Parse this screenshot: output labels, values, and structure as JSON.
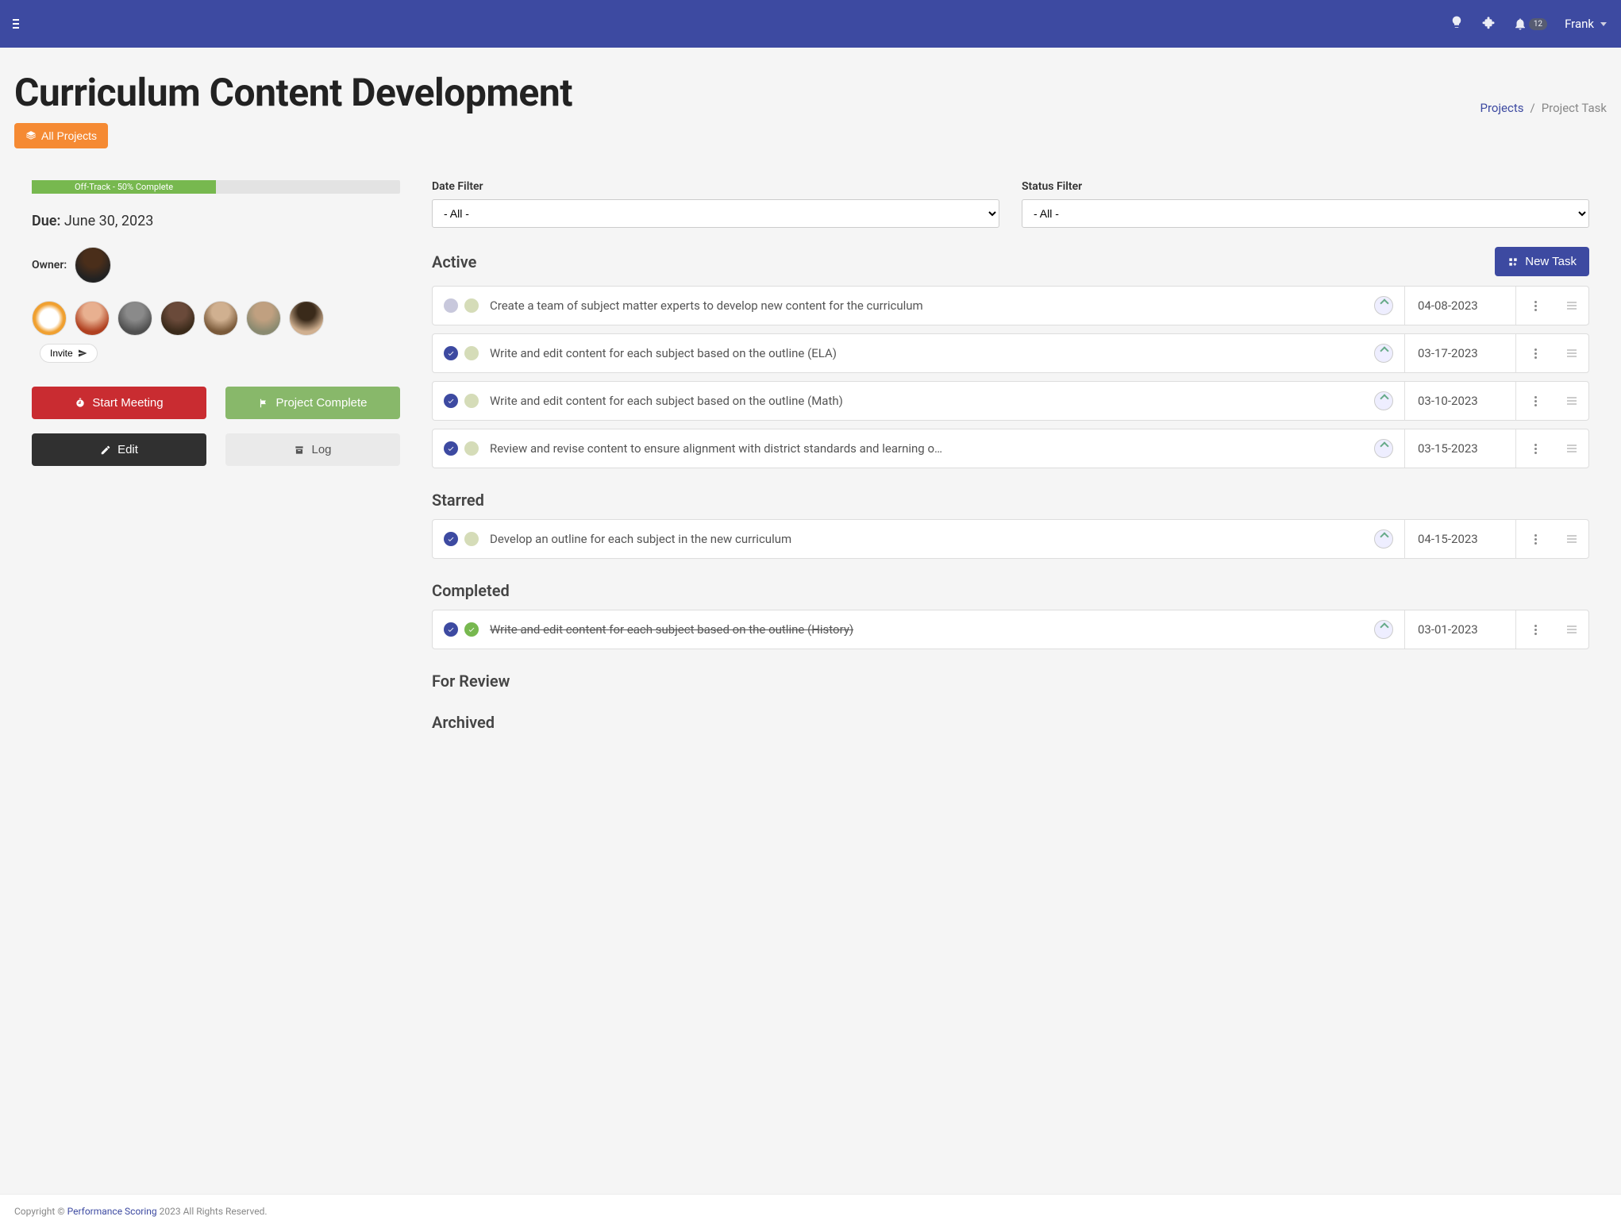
{
  "topbar": {
    "notif_count": "12",
    "username": "Frank"
  },
  "header": {
    "title": "Curriculum Content Development",
    "breadcrumb": {
      "projects": "Projects",
      "current": "Project Task"
    },
    "all_projects": "All Projects"
  },
  "project": {
    "progress_label": "Off-Track - 50% Complete",
    "due_label": "Due:",
    "due_date": "June 30, 2023",
    "owner_label": "Owner:",
    "invite_label": "Invite"
  },
  "actions": {
    "start_meeting": "Start Meeting",
    "project_complete": "Project Complete",
    "edit": "Edit",
    "log": "Log"
  },
  "filters": {
    "date_label": "Date Filter",
    "date_value": "- All -",
    "status_label": "Status Filter",
    "status_value": "- All -"
  },
  "new_task": "New Task",
  "sections": {
    "active": "Active",
    "starred": "Starred",
    "completed": "Completed",
    "for_review": "For Review",
    "archived": "Archived"
  },
  "tasks": {
    "active": [
      {
        "title": "Create a team of subject matter experts to develop new content for the curriculum",
        "date": "04-08-2023",
        "check1": "empty"
      },
      {
        "title": "Write and edit content for each subject based on the outline (ELA)",
        "date": "03-17-2023",
        "check1": "blue"
      },
      {
        "title": "Write and edit content for each subject based on the outline (Math)",
        "date": "03-10-2023",
        "check1": "blue"
      },
      {
        "title": "Review and revise content to ensure alignment with district standards and learning o…",
        "date": "03-15-2023",
        "check1": "blue"
      }
    ],
    "starred": [
      {
        "title": "Develop an outline for each subject in the new curriculum",
        "date": "04-15-2023",
        "check1": "blue"
      }
    ],
    "completed": [
      {
        "title": "Write and edit content for each subject based on the outline (History)",
        "date": "03-01-2023",
        "check1": "blue",
        "check2": "green",
        "strike": true
      }
    ]
  },
  "footer": {
    "prefix": "Copyright © ",
    "link": "Performance Scoring",
    "suffix": " 2023 All Rights Reserved."
  }
}
